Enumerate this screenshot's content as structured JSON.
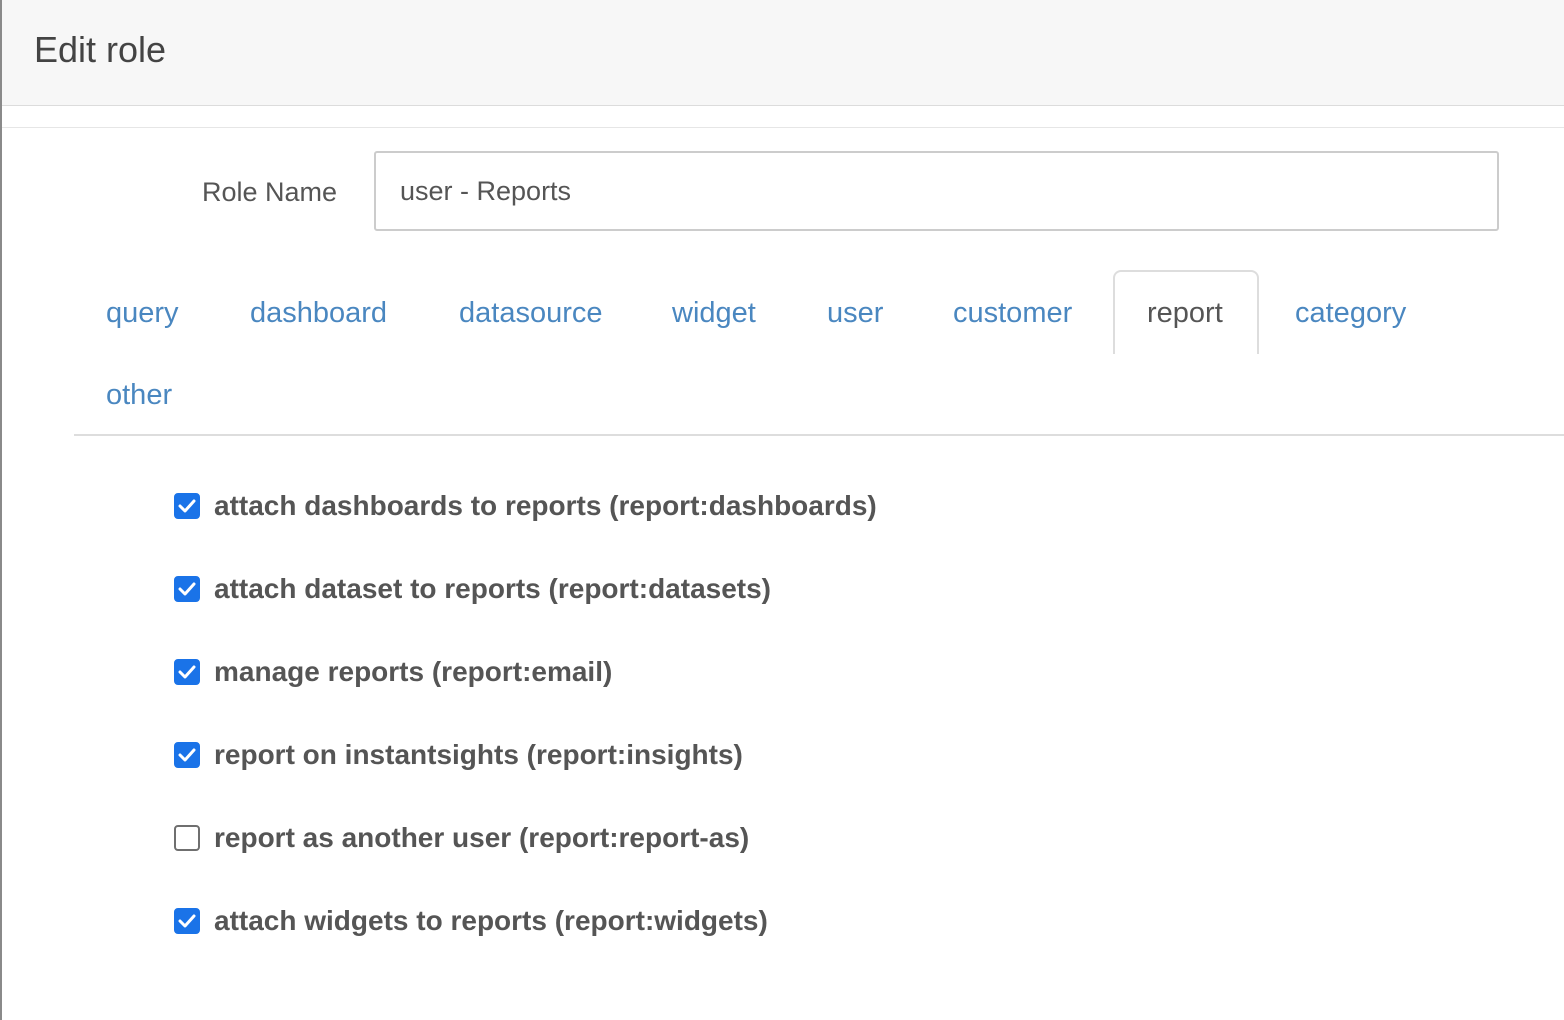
{
  "modal": {
    "title": "Edit role"
  },
  "form": {
    "role_name_label": "Role Name",
    "role_name_value": "user - Reports"
  },
  "tabs": [
    {
      "label": "query",
      "active": false
    },
    {
      "label": "dashboard",
      "active": false
    },
    {
      "label": "datasource",
      "active": false
    },
    {
      "label": "widget",
      "active": false
    },
    {
      "label": "user",
      "active": false
    },
    {
      "label": "customer",
      "active": false
    },
    {
      "label": "report",
      "active": true
    },
    {
      "label": "category",
      "active": false
    },
    {
      "label": "other",
      "active": false
    }
  ],
  "permissions": [
    {
      "label": "attach dashboards to reports (report:dashboards)",
      "checked": true
    },
    {
      "label": "attach dataset to reports (report:datasets)",
      "checked": true
    },
    {
      "label": "manage reports (report:email)",
      "checked": true
    },
    {
      "label": "report on instantsights (report:insights)",
      "checked": true
    },
    {
      "label": "report as another user (report:report-as)",
      "checked": false
    },
    {
      "label": "attach widgets to reports (report:widgets)",
      "checked": true
    }
  ],
  "colors": {
    "link": "#4a87c0",
    "checkbox_checked": "#1a73e8",
    "header_bg": "#f7f7f7"
  }
}
